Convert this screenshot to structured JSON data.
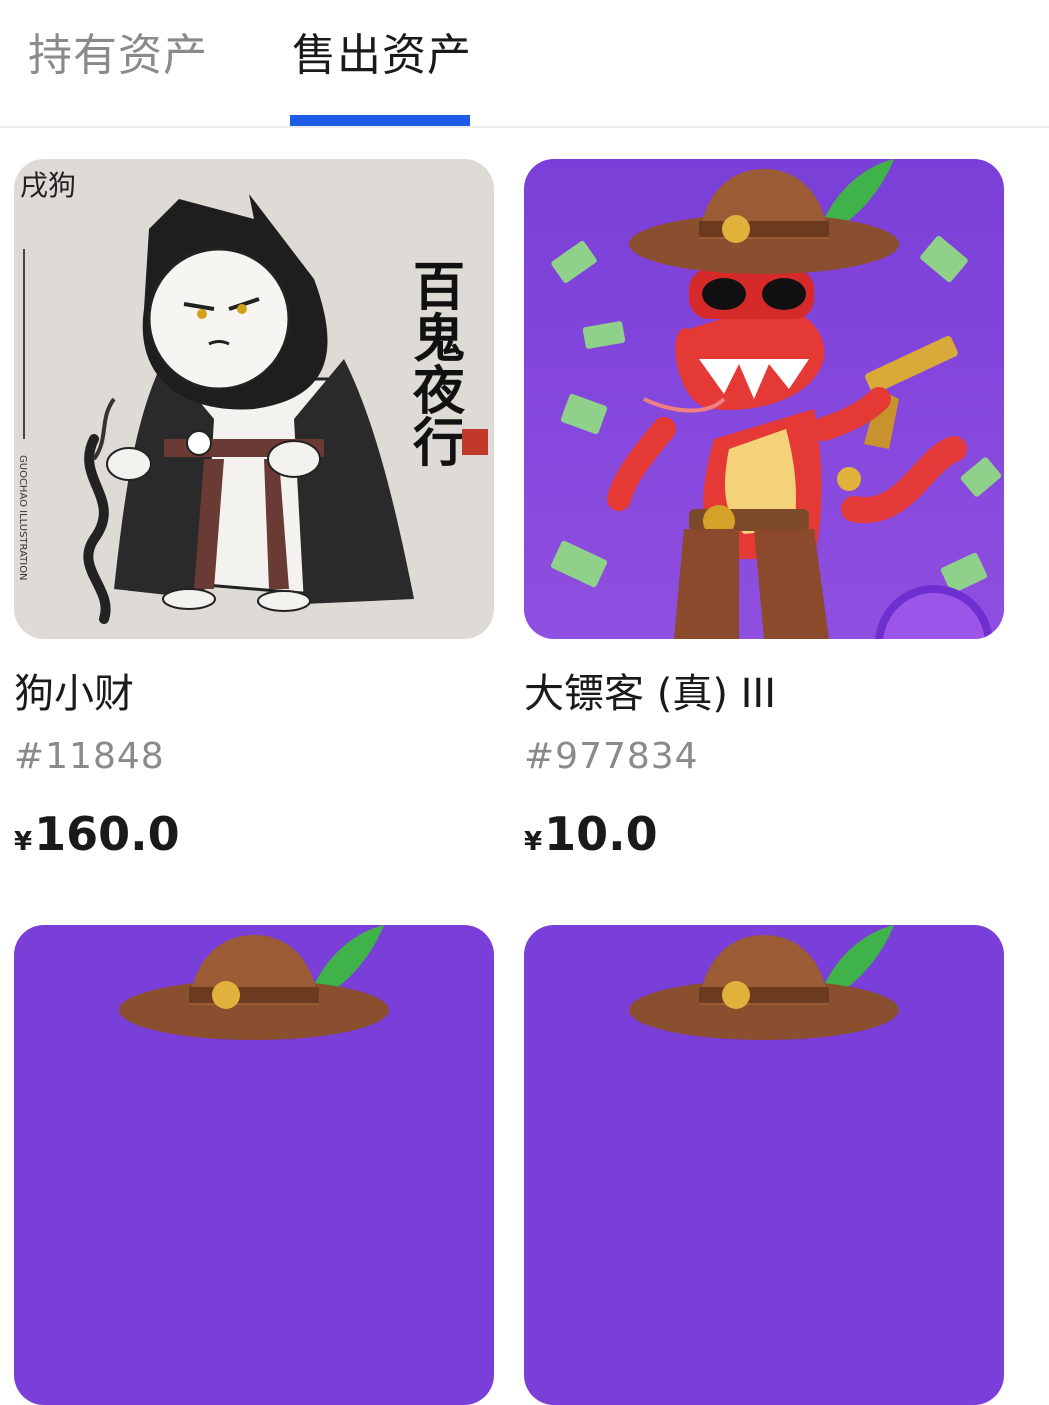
{
  "tabs": {
    "holding": "持有资产",
    "selling": "售出资产",
    "active": "selling",
    "indicator_color": "#1f5ce6"
  },
  "items": [
    {
      "name": "狗小财",
      "serial": "#11848",
      "currency": "¥",
      "price": "160.0",
      "image": {
        "subject": "hooded-cat-ink-illustration",
        "background": "#dddad5",
        "text": [
          "戌狗",
          "百鬼夜行",
          "GUOCHAO ILLUSTRATION"
        ]
      }
    },
    {
      "name": "大镖客 (真) III",
      "serial": "#977834",
      "currency": "¥",
      "price": "10.0",
      "image": {
        "subject": "cowboy-snake-with-revolver",
        "background": "#7c3bdb"
      }
    },
    {
      "image": {
        "subject": "cowboy-snake-with-revolver",
        "background": "#7c3bdb"
      }
    },
    {
      "image": {
        "subject": "cowboy-snake-with-revolver",
        "background": "#7c3bdb"
      }
    }
  ]
}
